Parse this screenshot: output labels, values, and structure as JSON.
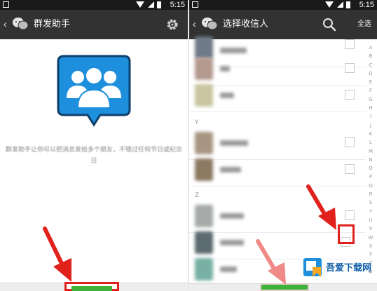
{
  "left": {
    "status_time": "5:15",
    "title": "群发助手",
    "description": "群发助手让你可以把消息发给多个朋友，不错过任何节日或纪念日"
  },
  "right": {
    "status_time": "5:15",
    "title": "选择收信人",
    "select_all": "全选",
    "sections": [
      {
        "letter": "Y"
      },
      {
        "letter": "Z"
      }
    ],
    "index_letters": [
      "A",
      "B",
      "C",
      "D",
      "E",
      "F",
      "G",
      "H",
      "I",
      "J",
      "K",
      "L",
      "M",
      "N",
      "O",
      "P",
      "Q",
      "R",
      "S",
      "T",
      "U",
      "V",
      "W",
      "X",
      "Y",
      "Z",
      "#"
    ]
  },
  "watermark": {
    "text": "吾爱下载网"
  },
  "colors": {
    "topbar": "#323232",
    "accent_green": "#3fb23a",
    "highlight_red": "#e0211c",
    "icon_blue": "#1e8fdc"
  }
}
